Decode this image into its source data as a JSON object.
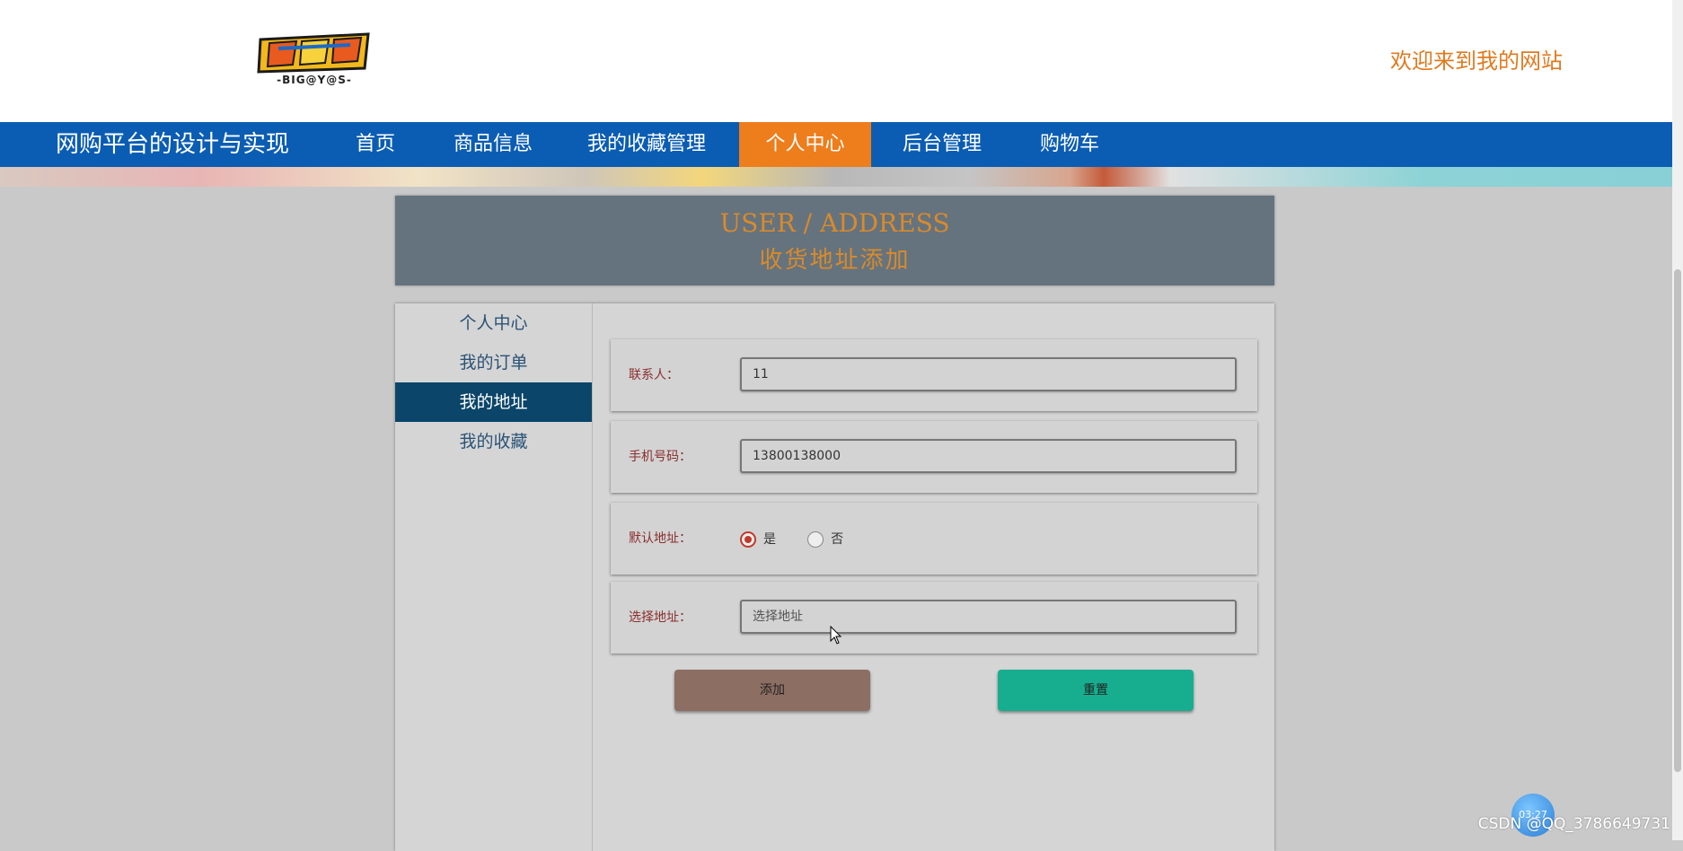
{
  "header": {
    "logo_text": "-BIG@Y@S-",
    "welcome": "欢迎来到我的网站"
  },
  "nav": {
    "brand": "网购平台的设计与实现",
    "items": [
      {
        "label": "首页"
      },
      {
        "label": "商品信息"
      },
      {
        "label": "我的收藏管理"
      },
      {
        "label": "个人中心",
        "active": true
      },
      {
        "label": "后台管理"
      },
      {
        "label": "购物车"
      }
    ]
  },
  "title_box": {
    "en": "USER / ADDRESS",
    "zh": "收货地址添加"
  },
  "sidebar": {
    "items": [
      {
        "label": "个人中心"
      },
      {
        "label": "我的订单"
      },
      {
        "label": "我的地址",
        "active": true
      },
      {
        "label": "我的收藏"
      }
    ]
  },
  "form": {
    "contact": {
      "label": "联系人：",
      "value": "11"
    },
    "phone": {
      "label": "手机号码：",
      "value": "13800138000"
    },
    "default_address": {
      "label": "默认地址：",
      "options": [
        {
          "label": "是",
          "checked": true
        },
        {
          "label": "否",
          "checked": false
        }
      ]
    },
    "address": {
      "label": "选择地址：",
      "placeholder": "选择地址"
    },
    "add_button": "添加",
    "reset_button": "重置"
  },
  "overlay": {
    "watermark": "CSDN @QQ_3786649731",
    "timer": "03:27"
  },
  "colors": {
    "nav_bg": "#0b5db3",
    "nav_active": "#ee7d1c",
    "welcome": "#e07a1f",
    "title_bg": "#65737e",
    "title_text": "#d98a2b",
    "sidebar_active": "#0b4569",
    "add_button": "#8d6e63",
    "reset_button": "#16ae8e"
  }
}
